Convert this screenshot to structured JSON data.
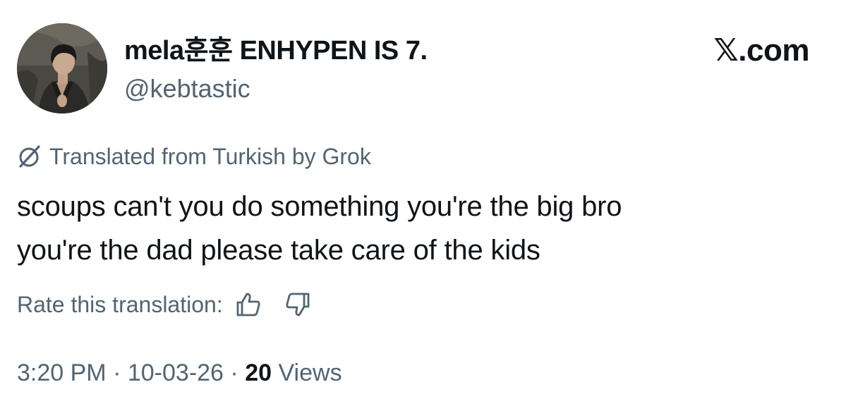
{
  "author": {
    "display_name": "mela훈훈 ENHYPEN IS 7.",
    "handle": "@kebtastic",
    "avatar_icon": "profile-photo"
  },
  "brand": {
    "label": "𝕏.com"
  },
  "translation": {
    "notice": "Translated from Turkish by Grok",
    "icon": "grok-icon"
  },
  "tweet": {
    "lines": [
      "scoups can't you do something you're the big bro",
      "you're the dad please take care of the kids"
    ]
  },
  "rating": {
    "label": "Rate this translation:",
    "up_icon": "thumbs-up-icon",
    "down_icon": "thumbs-down-icon"
  },
  "meta": {
    "time": "3:20 PM",
    "date": "10-03-26",
    "separator": "·",
    "views_count": "20",
    "views_label": "Views"
  },
  "colors": {
    "text_primary": "#0f1419",
    "text_secondary": "#536471",
    "background": "#ffffff"
  }
}
